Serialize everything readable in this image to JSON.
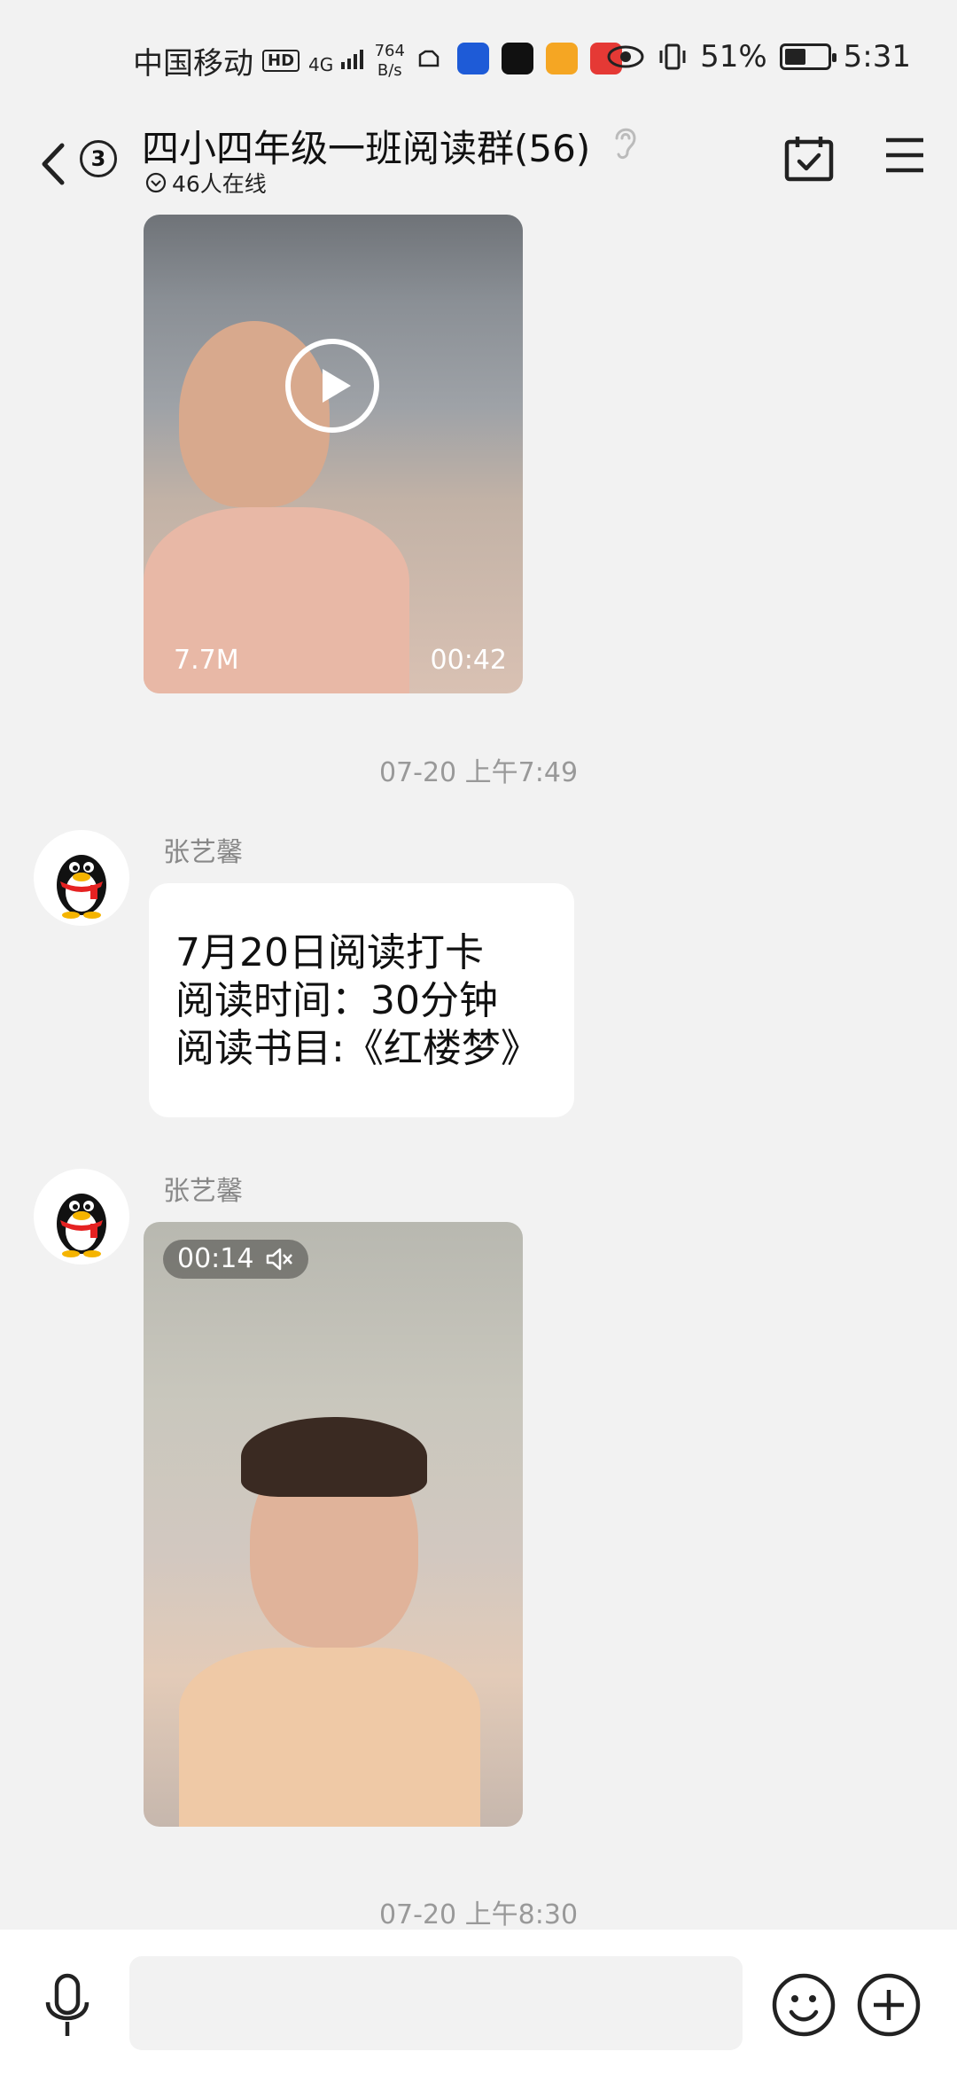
{
  "status_bar": {
    "carrier": "中国移动",
    "hd": "HD",
    "network": "4G",
    "speed_value": "764",
    "speed_unit": "B/s",
    "battery_percent": "51%",
    "battery_level": 0.51,
    "time": "5:31"
  },
  "header": {
    "unread_count": "3",
    "title": "四小四年级一班阅读群(56)",
    "online_status": "46人在线"
  },
  "messages": {
    "video1": {
      "size": "7.7M",
      "duration": "00:42"
    },
    "timestamp1": "07-20 上午7:49",
    "msg2": {
      "sender": "张艺馨",
      "lines": [
        "7月20日阅读打卡",
        "阅读时间：30分钟",
        "阅读书目:《红楼梦》"
      ]
    },
    "msg3": {
      "sender": "张艺馨",
      "duration": "00:14"
    },
    "timestamp2": "07-20 上午8:30"
  },
  "input_bar": {
    "placeholder": ""
  },
  "colors": {
    "background": "#f2f2f2",
    "bubble": "#ffffff",
    "timestamp": "#999999"
  },
  "icons": [
    "back-icon",
    "ear-icon",
    "calendar-check-icon",
    "menu-icon",
    "play-icon",
    "mute-icon",
    "mic-icon",
    "emoji-icon",
    "plus-icon",
    "qq-penguin-avatar"
  ]
}
